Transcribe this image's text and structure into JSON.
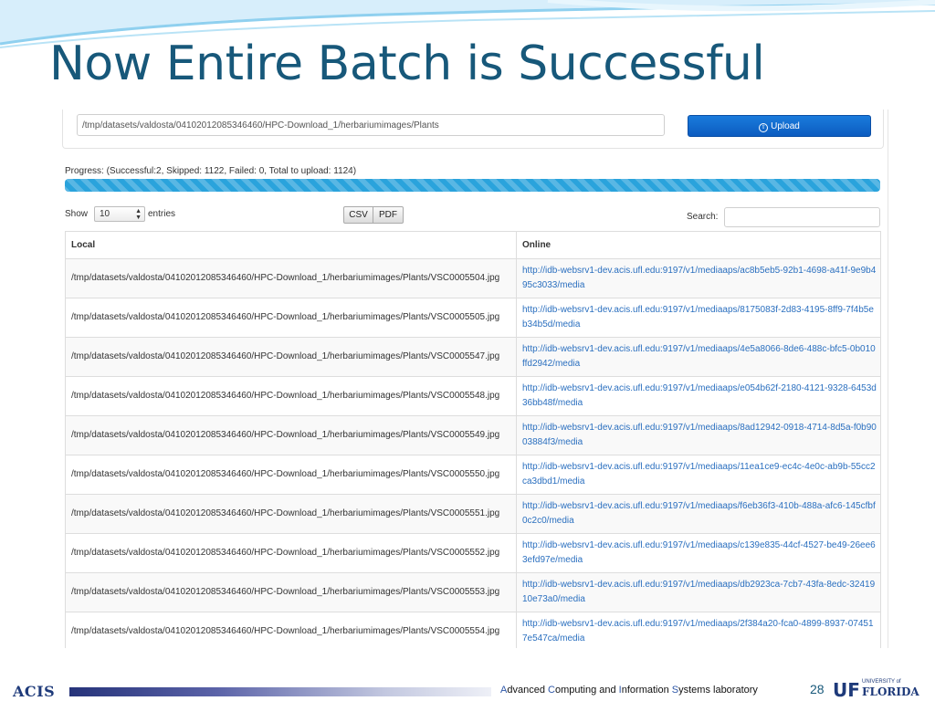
{
  "slide": {
    "title": "Now Entire Batch is Successful",
    "page_number": "28"
  },
  "upload": {
    "path_value": "/tmp/datasets/valdosta/04102012085346460/HPC-Download_1/herbariumimages/Plants",
    "button_label": "Upload",
    "button_icon": "upload-circle-icon"
  },
  "progress": {
    "text": "Progress: (Successful:2, Skipped: 1122, Failed: 0, Total to upload: 1124)",
    "fraction": 1.0
  },
  "controls": {
    "show_label": "Show",
    "entries_value": "10",
    "entries_label": "entries",
    "csv_label": "CSV",
    "pdf_label": "PDF",
    "search_label": "Search:"
  },
  "table": {
    "headers": [
      "Local",
      "Online"
    ],
    "rows": [
      {
        "local": "/tmp/datasets/valdosta/04102012085346460/HPC-Download_1/herbariumimages/Plants/VSC0005504.jpg",
        "online": "http://idb-websrv1-dev.acis.ufl.edu:9197/v1/mediaaps/ac8b5eb5-92b1-4698-a41f-9e9b495c3033/media"
      },
      {
        "local": "/tmp/datasets/valdosta/04102012085346460/HPC-Download_1/herbariumimages/Plants/VSC0005505.jpg",
        "online": "http://idb-websrv1-dev.acis.ufl.edu:9197/v1/mediaaps/8175083f-2d83-4195-8ff9-7f4b5eb34b5d/media"
      },
      {
        "local": "/tmp/datasets/valdosta/04102012085346460/HPC-Download_1/herbariumimages/Plants/VSC0005547.jpg",
        "online": "http://idb-websrv1-dev.acis.ufl.edu:9197/v1/mediaaps/4e5a8066-8de6-488c-bfc5-0b010ffd2942/media"
      },
      {
        "local": "/tmp/datasets/valdosta/04102012085346460/HPC-Download_1/herbariumimages/Plants/VSC0005548.jpg",
        "online": "http://idb-websrv1-dev.acis.ufl.edu:9197/v1/mediaaps/e054b62f-2180-4121-9328-6453d36bb48f/media"
      },
      {
        "local": "/tmp/datasets/valdosta/04102012085346460/HPC-Download_1/herbariumimages/Plants/VSC0005549.jpg",
        "online": "http://idb-websrv1-dev.acis.ufl.edu:9197/v1/mediaaps/8ad12942-0918-4714-8d5a-f0b9003884f3/media"
      },
      {
        "local": "/tmp/datasets/valdosta/04102012085346460/HPC-Download_1/herbariumimages/Plants/VSC0005550.jpg",
        "online": "http://idb-websrv1-dev.acis.ufl.edu:9197/v1/mediaaps/11ea1ce9-ec4c-4e0c-ab9b-55cc2ca3dbd1/media"
      },
      {
        "local": "/tmp/datasets/valdosta/04102012085346460/HPC-Download_1/herbariumimages/Plants/VSC0005551.jpg",
        "online": "http://idb-websrv1-dev.acis.ufl.edu:9197/v1/mediaaps/f6eb36f3-410b-488a-afc6-145cfbf0c2c0/media"
      },
      {
        "local": "/tmp/datasets/valdosta/04102012085346460/HPC-Download_1/herbariumimages/Plants/VSC0005552.jpg",
        "online": "http://idb-websrv1-dev.acis.ufl.edu:9197/v1/mediaaps/c139e835-44cf-4527-be49-26ee63efd97e/media"
      },
      {
        "local": "/tmp/datasets/valdosta/04102012085346460/HPC-Download_1/herbariumimages/Plants/VSC0005553.jpg",
        "online": "http://idb-websrv1-dev.acis.ufl.edu:9197/v1/mediaaps/db2923ca-7cb7-43fa-8edc-3241910e73a0/media"
      },
      {
        "local": "/tmp/datasets/valdosta/04102012085346460/HPC-Download_1/herbariumimages/Plants/VSC0005554.jpg",
        "online": "http://idb-websrv1-dev.acis.ufl.edu:9197/v1/mediaaps/2f384a20-fca0-4899-8937-074517e547ca/media"
      }
    ]
  },
  "footer": {
    "logo_left": "ACIS",
    "lab_parts": [
      {
        "cap": "A",
        "rest": "dvanced "
      },
      {
        "cap": "C",
        "rest": "omputing and "
      },
      {
        "cap": "I",
        "rest": "nformation "
      },
      {
        "cap": "S",
        "rest": "ystems laboratory"
      }
    ],
    "logo_right_mark": "UF",
    "logo_right_sub": "UNIVERSITY of",
    "logo_right_name": "FLORIDA"
  },
  "colors": {
    "title": "#17587a",
    "upload_button": "#1a6fd3",
    "progress_bar": "#2aa3dc",
    "link": "#2a6fbf",
    "footer_bar": "#26337a"
  }
}
